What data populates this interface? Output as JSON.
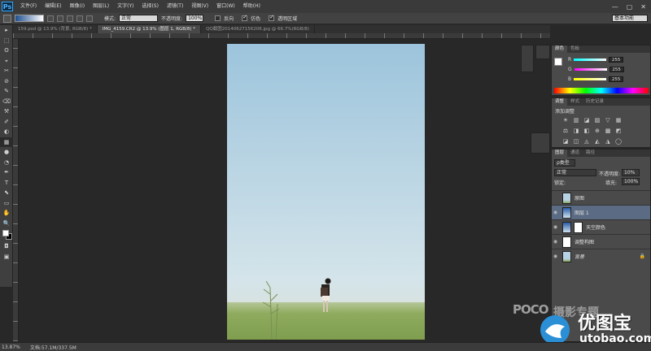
{
  "app": {
    "logo": "Ps"
  },
  "menu": [
    "文件(F)",
    "编辑(E)",
    "图像(I)",
    "图层(L)",
    "文字(Y)",
    "选择(S)",
    "滤镜(T)",
    "视图(V)",
    "窗口(W)",
    "帮助(H)"
  ],
  "window_buttons": [
    "—",
    "▢",
    "✕"
  ],
  "options": {
    "mode_label": "模式:",
    "mode_value": "正常",
    "opacity_label": "不透明度:",
    "opacity_value": "100%",
    "reverse_label": "反向",
    "dither_label": "仿色",
    "transparency_label": "透明区域",
    "workspace": "基本功能"
  },
  "tabs": [
    {
      "label": "159.psd @ 13.9% (背景, RGB/8) *"
    },
    {
      "label": "IMG_4159.CR2 @ 13.9% (图层 1, RGB/8) *"
    },
    {
      "label": "QQ截图20140627156206.jpg @ 66.7%(RGB/8)"
    }
  ],
  "tools": [
    "▸",
    "⬚",
    "ʘ",
    "⌖",
    "✂",
    "⊘",
    "✎",
    "⌫",
    "⚒",
    "✐",
    "◐",
    "▦",
    "●",
    "◔",
    "✒",
    "T",
    "⬉",
    "▭",
    "✋",
    "🔍"
  ],
  "color_panel": {
    "tabs": [
      "颜色",
      "色板"
    ],
    "channels": [
      {
        "name": "R",
        "value": "255",
        "color": "#ff3b3b"
      },
      {
        "name": "G",
        "value": "255",
        "color": "#3bff3b"
      },
      {
        "name": "B",
        "value": "255",
        "color": "#3b6bff"
      }
    ]
  },
  "adjustments_panel": {
    "tabs": [
      "调整",
      "样式",
      "历史记录"
    ],
    "title": "添加调整",
    "icons": [
      "☀",
      "▥",
      "◪",
      "▨",
      "▽",
      "▦",
      "⚖",
      "◨",
      "◧",
      "⊕",
      "▩",
      "◩",
      "◪",
      "◫",
      "◬",
      "◭",
      "◮",
      "◯"
    ]
  },
  "layers_panel": {
    "tabs": [
      "图层",
      "通道",
      "路径"
    ],
    "filter_label": "ρ类型",
    "blend": "正常",
    "opacity_label": "不透明度:",
    "opacity_value": "10%",
    "lock_label": "锁定:",
    "fill_label": "填充:",
    "fill_value": "100%",
    "layers": [
      {
        "name": "原图",
        "visible": false,
        "thumb": "photo"
      },
      {
        "name": "图层 1",
        "visible": true,
        "thumb": "sky",
        "selected": true
      },
      {
        "name": "天空颜色",
        "visible": true,
        "thumb": "sky",
        "mask": true
      },
      {
        "name": "调整构图",
        "visible": true,
        "thumb": "white"
      },
      {
        "name": "背景",
        "visible": true,
        "thumb": "photo",
        "locked": true
      }
    ]
  },
  "status": {
    "zoom": "13.87%",
    "doc": "文档:57.1M/337.5M"
  },
  "watermarks": {
    "poco": "POCO",
    "poco_sub": "摄影专题",
    "brand_cn": "优图宝",
    "brand_url": "utobao.com"
  }
}
